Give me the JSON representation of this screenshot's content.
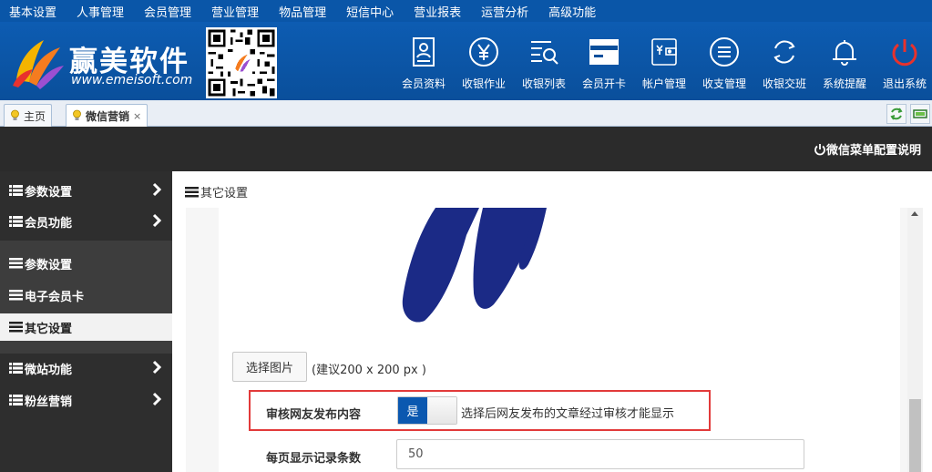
{
  "topmenu": [
    "基本设置",
    "人事管理",
    "会员管理",
    "营业管理",
    "物品管理",
    "短信中心",
    "营业报表",
    "运营分析",
    "高级功能"
  ],
  "brand": {
    "name": "赢美软件",
    "url": "www.emeisoft.com"
  },
  "toolbar": [
    {
      "label": "会员资料",
      "icon": "member-profile-icon"
    },
    {
      "label": "收银作业",
      "icon": "yen-circle-icon"
    },
    {
      "label": "收银列表",
      "icon": "list-search-icon"
    },
    {
      "label": "会员开卡",
      "icon": "card-icon"
    },
    {
      "label": "帐户管理",
      "icon": "wallet-icon"
    },
    {
      "label": "收支管理",
      "icon": "menu-circle-icon"
    },
    {
      "label": "收银交班",
      "icon": "cycle-icon"
    },
    {
      "label": "系统提醒",
      "icon": "bell-icon"
    },
    {
      "label": "退出系统",
      "icon": "power-icon"
    }
  ],
  "tabs": {
    "home": "主页",
    "current": "微信营销",
    "close": "×"
  },
  "darkbar": {
    "help": "微信菜单配置说明"
  },
  "sidebar": {
    "params_group": "参数设置",
    "member_func": "会员功能",
    "sub_params": "参数设置",
    "ecard": "电子会员卡",
    "other": "其它设置",
    "microsite": "微站功能",
    "fans": "粉丝营销"
  },
  "content": {
    "header": "其它设置",
    "pick_button": "选择图片",
    "pick_hint": "(建议200 x 200 px )",
    "review_label": "审核网友发布内容",
    "review_toggle": "是",
    "review_hint": "选择后网友发布的文章经过审核才能显示",
    "pagesize_label": "每页显示记录条数",
    "pagesize_value": "50"
  },
  "colors": {
    "brand_blue": "#0b58b0",
    "dark": "#2b2b2b",
    "highlight_border": "#e23a3a",
    "power_red": "#e8322d"
  }
}
